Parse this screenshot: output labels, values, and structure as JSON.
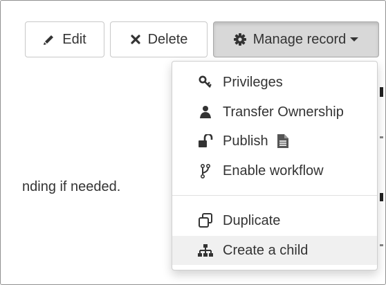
{
  "toolbar": {
    "edit_label": "Edit",
    "delete_label": "Delete",
    "manage_label": "Manage record"
  },
  "background": {
    "text_fragment": "nding if needed."
  },
  "menu": {
    "items": [
      {
        "label": "Privileges",
        "icon": "key-icon"
      },
      {
        "label": "Transfer Ownership",
        "icon": "user-icon"
      },
      {
        "label": "Publish",
        "icon": "unlock-icon"
      },
      {
        "label": "Enable workflow",
        "icon": "branch-icon"
      },
      {
        "label": "Duplicate",
        "icon": "copy-icon"
      },
      {
        "label": "Create a child",
        "icon": "sitemap-icon"
      }
    ]
  },
  "colors": {
    "text": "#333333",
    "active_button_bg": "#d8d8d8",
    "hover_item_bg": "#f0f0f0"
  }
}
